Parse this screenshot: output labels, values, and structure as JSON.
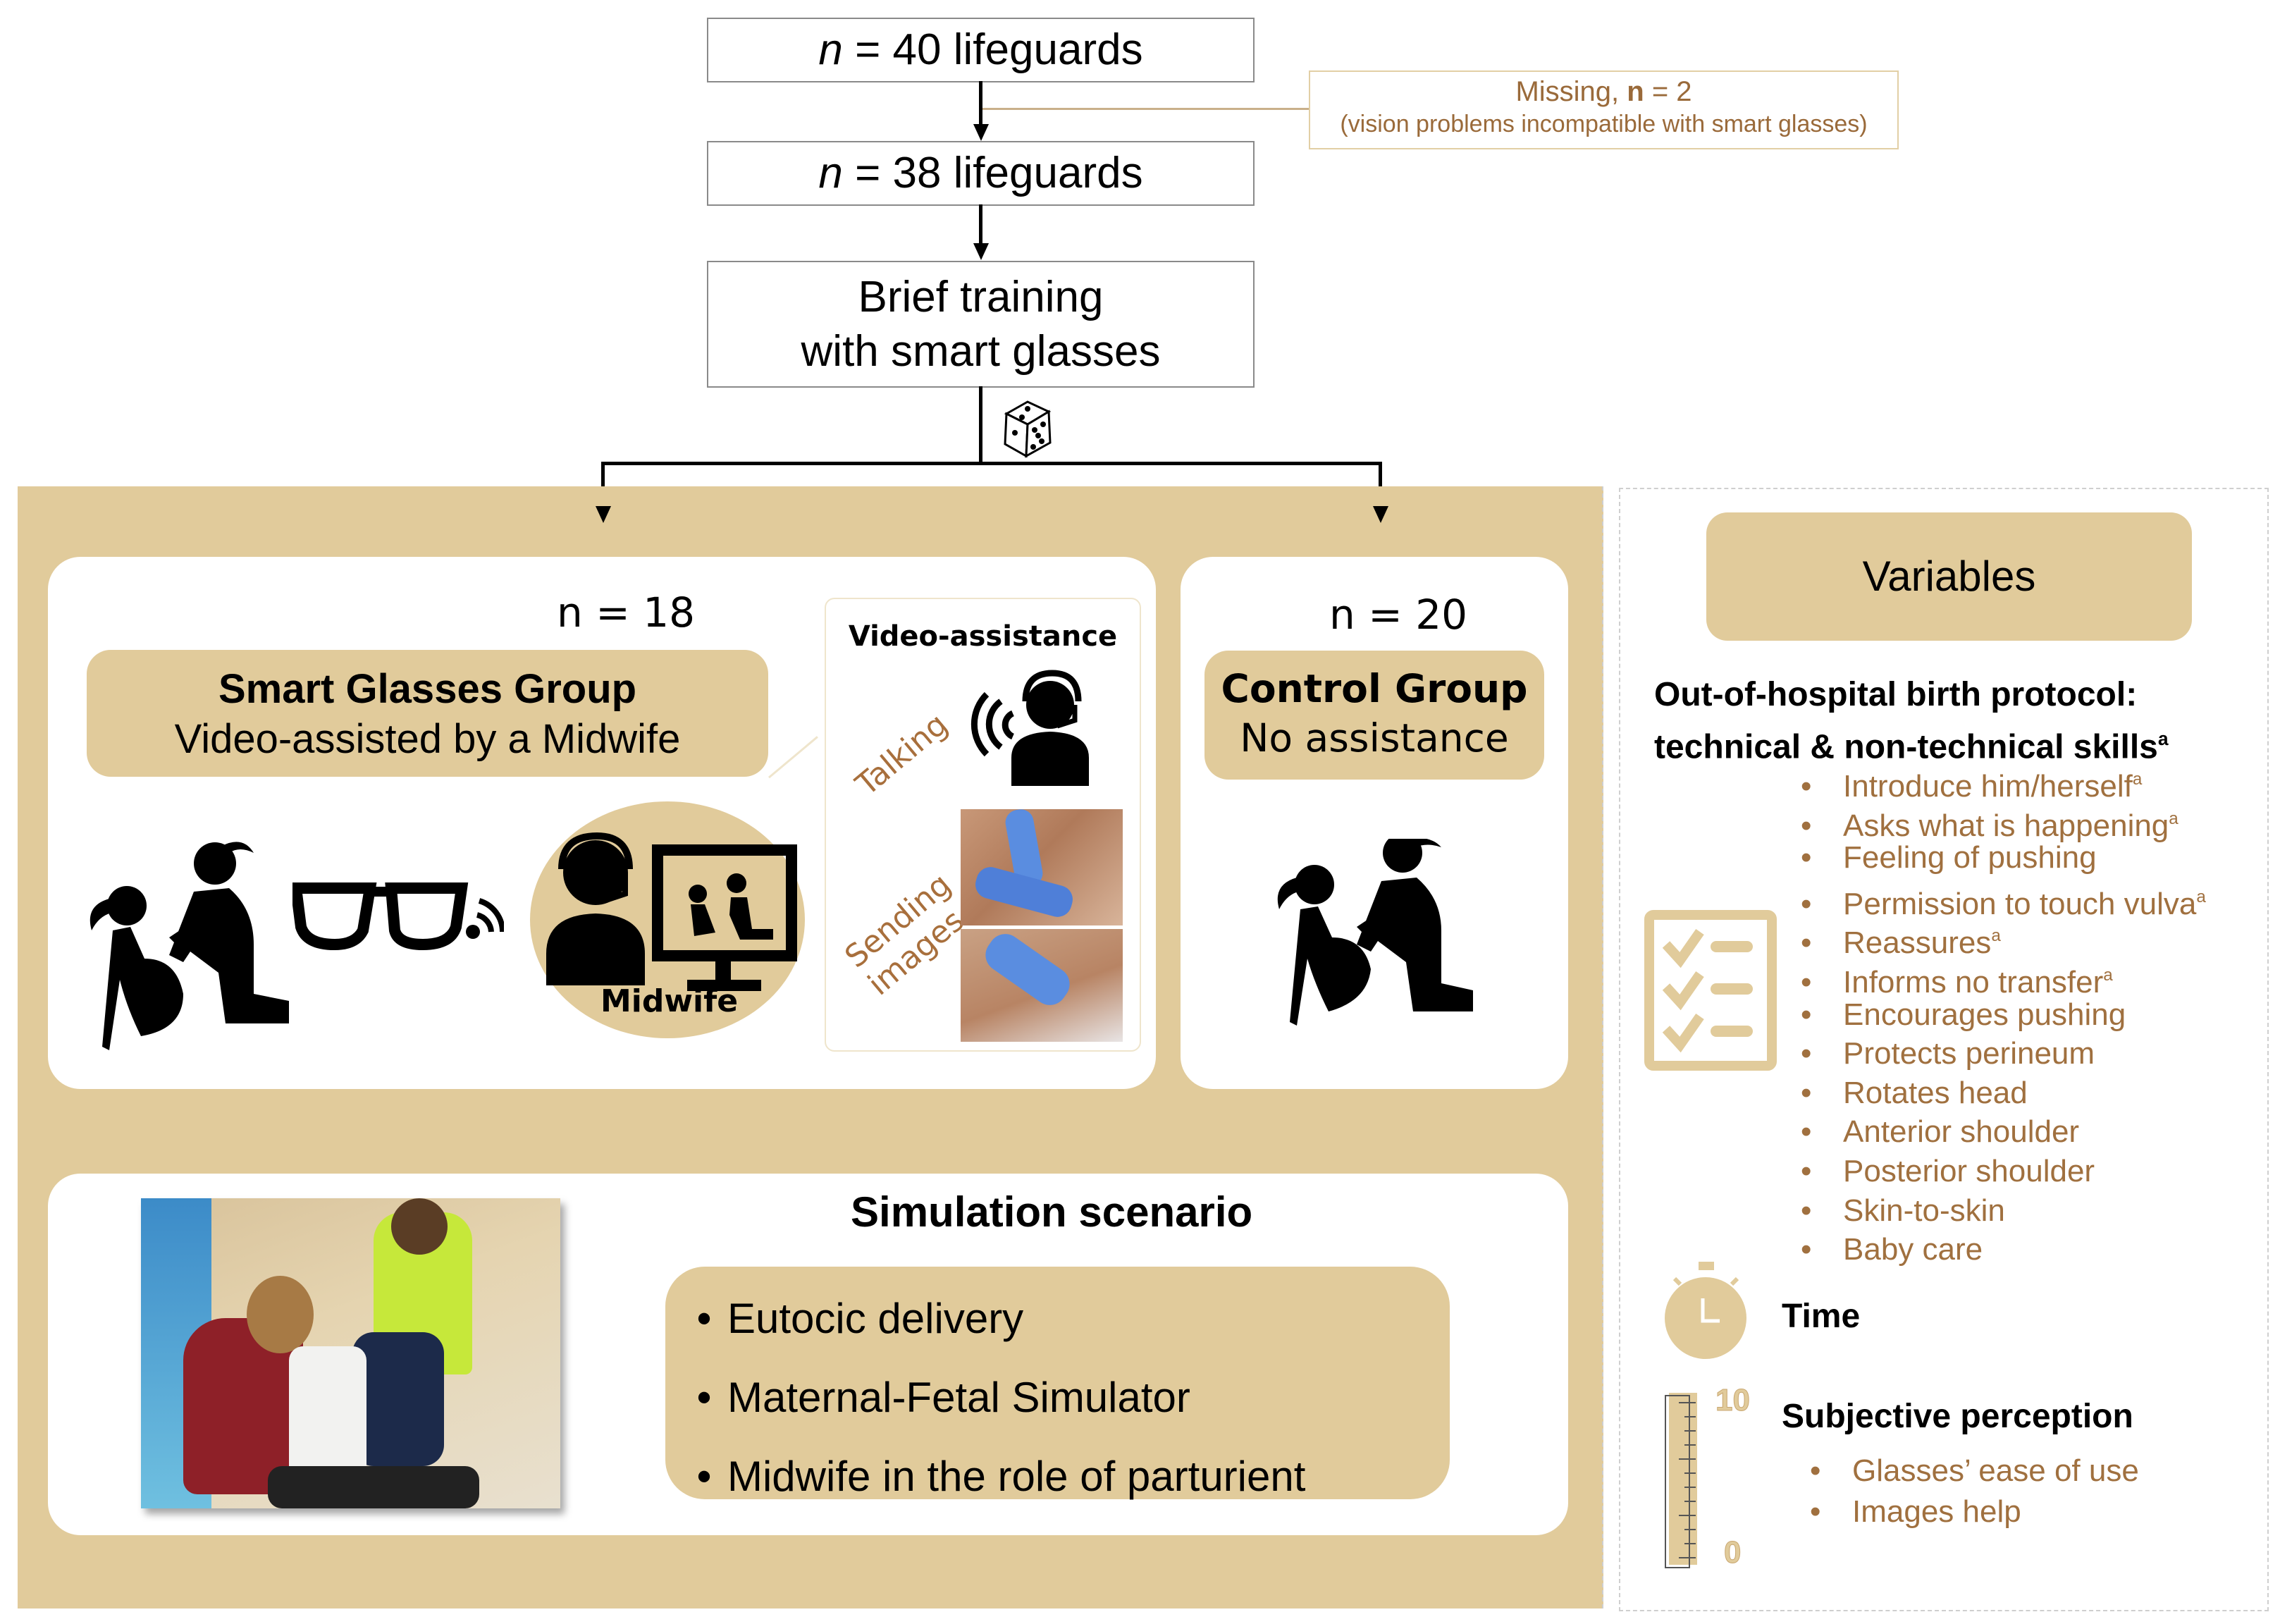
{
  "flow": {
    "box1": {
      "n_symbol": "n",
      "text": " = 40 lifeguards"
    },
    "missing": {
      "label": "Missing, ",
      "n_label": "n",
      "n_value": " = 2",
      "reason": "(vision problems incompatible with smart glasses)"
    },
    "box2": {
      "n_symbol": "n",
      "text": " = 38 lifeguards"
    },
    "training": {
      "line1": "Brief training",
      "line2": "with smart glasses"
    },
    "randomization_icon": "dice-icon"
  },
  "smart_glasses_group": {
    "n_label": "n = 18",
    "title": "Smart Glasses Group",
    "subtitle": "Video-assisted by a Midwife",
    "midwife_label": "Midwife",
    "video_assistance": {
      "title": "Video-assistance",
      "talking_label": "Talking",
      "sending_label_line1": "Sending",
      "sending_label_line2": "images"
    }
  },
  "control_group": {
    "n_label": "n = 20",
    "title": "Control Group",
    "subtitle": "No assistance"
  },
  "simulation": {
    "title": "Simulation scenario",
    "bullet": "•",
    "items": [
      "Eutocic delivery",
      "Maternal-Fetal Simulator",
      "Midwife in the role of parturient"
    ]
  },
  "variables": {
    "title": "Variables",
    "protocol_heading_line1": "Out-of-hospital birth protocol:",
    "protocol_heading_line2": "technical & non-technical skills",
    "protocol_heading_sup": "a",
    "bullet": "•",
    "skills": [
      {
        "label": "Introduce him/herself",
        "sup": "a"
      },
      {
        "label": "Asks what is happening",
        "sup": "a"
      },
      {
        "label": "Feeling of pushing",
        "sup": ""
      },
      {
        "label": "Permission to touch vulva",
        "sup": "a"
      },
      {
        "label": "Reassures",
        "sup": "a"
      },
      {
        "label": "Informs no transfer",
        "sup": "a"
      },
      {
        "label": "Encourages pushing",
        "sup": ""
      },
      {
        "label": "Protects perineum",
        "sup": ""
      },
      {
        "label": "Rotates head",
        "sup": ""
      },
      {
        "label": "Anterior shoulder",
        "sup": ""
      },
      {
        "label": "Posterior shoulder",
        "sup": ""
      },
      {
        "label": "Skin-to-skin",
        "sup": ""
      },
      {
        "label": "Baby care",
        "sup": ""
      }
    ],
    "time_label": "Time",
    "perception_heading": "Subjective perception",
    "scale_max": "10",
    "scale_min": "0",
    "perception_items": [
      "Glasses’ ease of use",
      "Images help"
    ]
  },
  "colors": {
    "tan": "#e1cb9b",
    "brown_text": "#a0703f",
    "black": "#000000"
  }
}
